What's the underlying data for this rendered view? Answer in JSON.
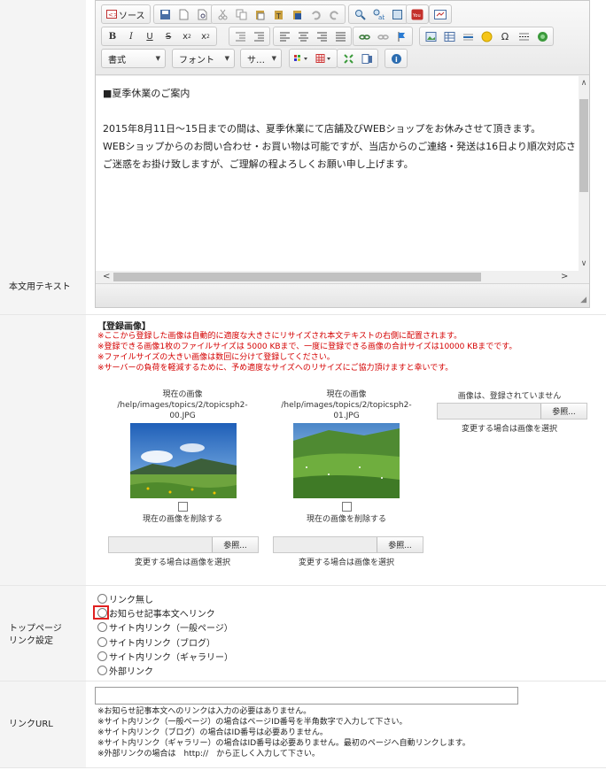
{
  "editor": {
    "label": "本文用テキスト",
    "toolbar": {
      "source_label": "ソース",
      "format_combo": "書式",
      "font_combo": "フォント",
      "size_combo": "サ…"
    },
    "content": {
      "heading": "■夏季休業のご案内",
      "line1": "2015年8月11日～15日までの間は、夏季休業にて店舗及びWEBショップをお休みさせて頂きます。",
      "line2": "WEBショップからのお問い合わせ・お買い物は可能ですが、当店からのご連絡・発送は16日より順次対応さ",
      "line3": "ご迷惑をお掛け致しますが、ご理解の程よろしくお願い申し上げます。"
    }
  },
  "images": {
    "heading": "【登録画像】",
    "notes": [
      "※ここから登録した画像は自動的に適度な大きさにリサイズされ本文テキストの右側に配置されます。",
      "※登録できる画像1枚のファイルサイズは 5000 KBまで、一度に登録できる画像の合計サイズは10000 KBまでです。",
      "※ファイルサイズの大きい画像は数回に分けて登録してください。",
      "※サーバーの負荷を軽減するために、予め適度なサイズへのリサイズにご協力頂けますと幸いです。"
    ],
    "slots": [
      {
        "current_label": "現在の画像",
        "path_line1": "/help/images/topics/2/topicsph2-",
        "path_line2": "00.JPG",
        "delete_label": "現在の画像を削除する",
        "browse_label": "参照...",
        "change_hint": "変更する場合は画像を選択"
      },
      {
        "current_label": "現在の画像",
        "path_line1": "/help/images/topics/2/topicsph2-",
        "path_line2": "01.JPG",
        "delete_label": "現在の画像を削除する",
        "browse_label": "参照...",
        "change_hint": "変更する場合は画像を選択"
      },
      {
        "none_label": "画像は、登録されていません",
        "browse_label": "参照...",
        "change_hint": "変更する場合は画像を選択"
      }
    ]
  },
  "top_link": {
    "label_line1": "トップページ",
    "label_line2": "リンク設定",
    "options": [
      "リンク無し",
      "お知らせ記事本文へリンク",
      "サイト内リンク（一般ページ）",
      "サイト内リンク（ブログ）",
      "サイト内リンク（ギャラリー）",
      "外部リンク"
    ]
  },
  "link_url": {
    "label": "リンクURL",
    "value": "",
    "notes": [
      "※お知らせ記事本文へのリンクは入力の必要はありません。",
      "※サイト内リンク（一般ページ）の場合はページID番号を半角数字で入力して下さい。",
      "※サイト内リンク（ブログ）の場合はID番号は必要ありません。",
      "※サイト内リンク（ギャラリー）の場合はID番号は必要ありません。最初のページへ自動リンクします。",
      "※外部リンクの場合は　http://　から正しく入力して下さい。"
    ]
  },
  "colors": {
    "note_red": "#d40000",
    "highlight": "#e02020"
  }
}
